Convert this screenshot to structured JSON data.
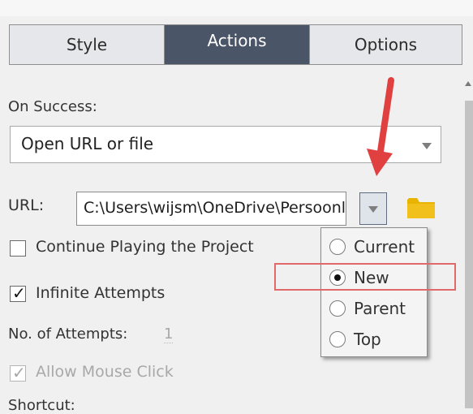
{
  "tabs": [
    {
      "label": "Style",
      "active": false
    },
    {
      "label": "Actions",
      "active": true
    },
    {
      "label": "Options",
      "active": false
    }
  ],
  "on_success": {
    "label": "On Success:",
    "value": "Open URL or file"
  },
  "url": {
    "label": "URL:",
    "value": "C:\\Users\\wijsm\\OneDrive\\Persoonlijk"
  },
  "continue_playing": {
    "label": "Continue Playing the Project",
    "checked": false
  },
  "infinite_attempts": {
    "label": "Infinite Attempts",
    "checked": true
  },
  "attempts": {
    "label": "No. of Attempts:",
    "value": "1"
  },
  "allow_mouse_click": {
    "label": "Allow Mouse Click",
    "checked": true,
    "disabled": true
  },
  "shortcut": {
    "label": "Shortcut:"
  },
  "window_menu": {
    "options": [
      {
        "label": "Current",
        "selected": false
      },
      {
        "label": "New",
        "selected": true
      },
      {
        "label": "Parent",
        "selected": false
      },
      {
        "label": "Top",
        "selected": false
      }
    ]
  },
  "colors": {
    "active_tab": "#4b5568",
    "annotation_red": "#e04040",
    "folder_yellow": "#e8b400"
  }
}
